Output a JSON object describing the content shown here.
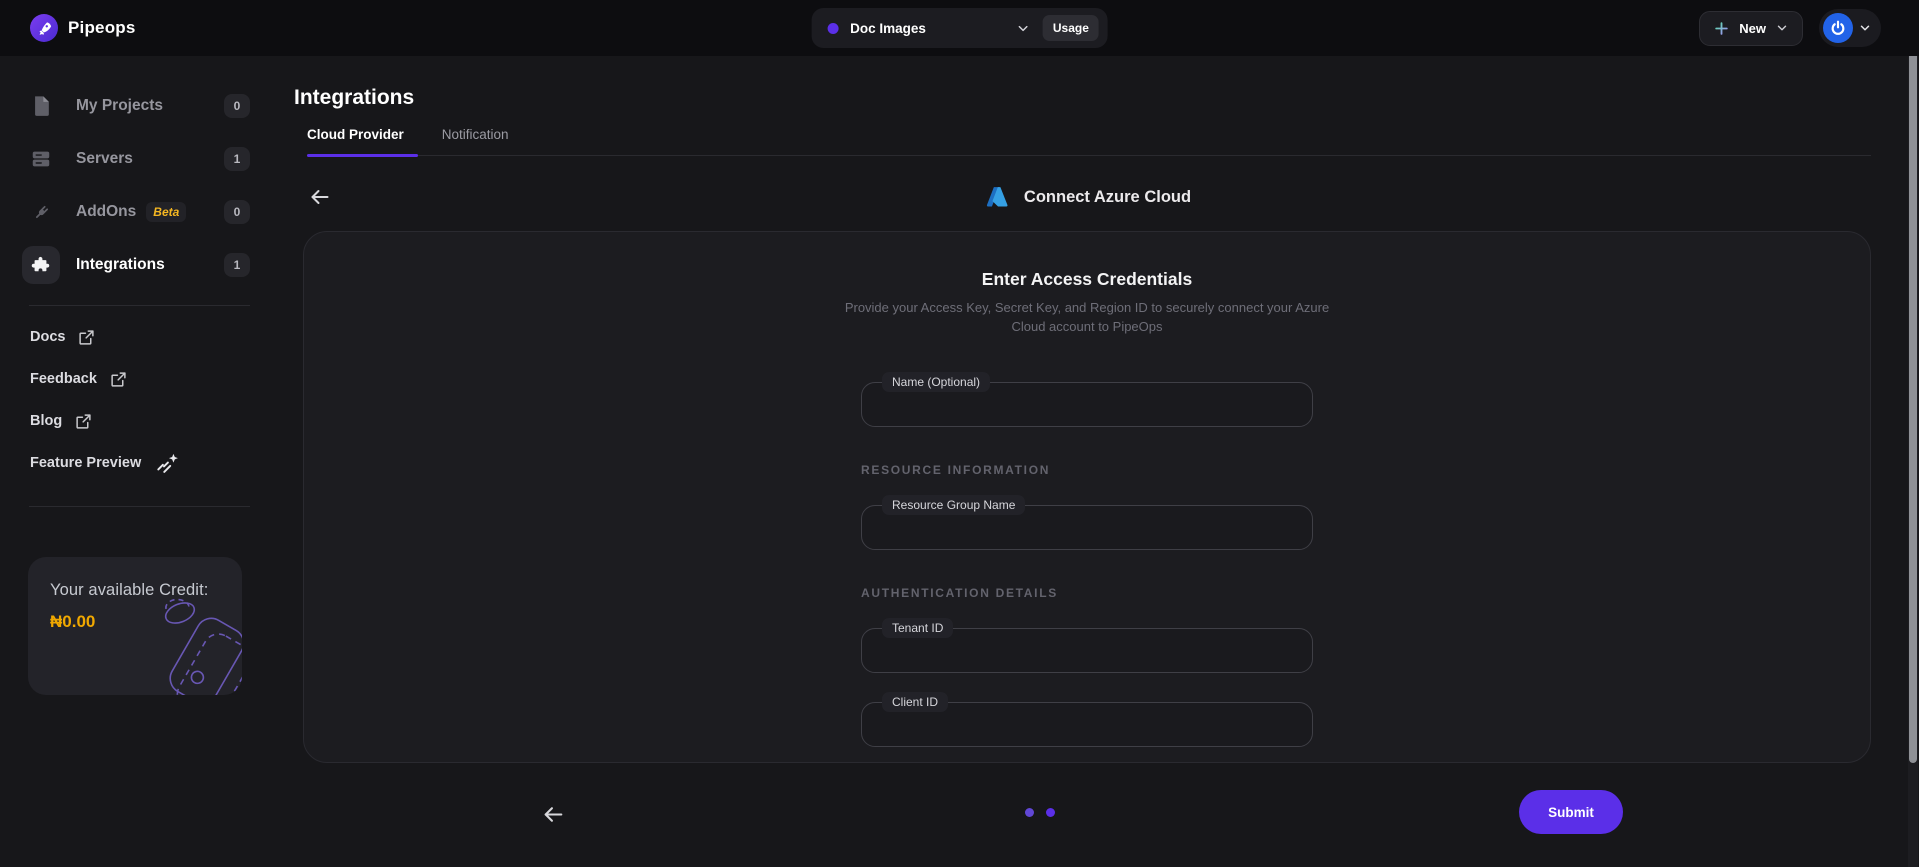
{
  "brand": {
    "name": "Pipeops"
  },
  "topbar": {
    "project": {
      "name": "Doc Images",
      "usage": "Usage"
    },
    "new_button": "New"
  },
  "sidebar": {
    "items": [
      {
        "label": "My Projects",
        "count": "0",
        "icon": "document-icon"
      },
      {
        "label": "Servers",
        "count": "1",
        "icon": "server-icon"
      },
      {
        "label": "AddOns",
        "beta": "Beta",
        "count": "0",
        "icon": "plug-icon"
      },
      {
        "label": "Integrations",
        "count": "1",
        "icon": "puzzle-icon",
        "active": true
      }
    ],
    "links": [
      {
        "label": "Docs",
        "icon": "external-link-icon"
      },
      {
        "label": "Feedback",
        "icon": "external-link-icon"
      },
      {
        "label": "Blog",
        "icon": "external-link-icon"
      },
      {
        "label": "Feature Preview",
        "icon": "shooting-star-icon"
      }
    ],
    "credit": {
      "label": "Your available Credit:",
      "amount": "₦0.00"
    }
  },
  "main": {
    "title": "Integrations",
    "tabs": [
      {
        "label": "Cloud Provider",
        "active": true
      },
      {
        "label": "Notification",
        "active": false
      }
    ],
    "provider": {
      "title": "Connect Azure Cloud",
      "icon": "azure-logo"
    },
    "form": {
      "heading": "Enter Access Credentials",
      "description": "Provide your Access Key, Secret Key, and Region ID to securely connect your Azure Cloud account to PipeOps",
      "name_field": {
        "label": "Name (Optional)",
        "value": "",
        "placeholder": ""
      },
      "resource_section": {
        "title": "RESOURCE INFORMATION",
        "fields": [
          {
            "label": "Resource Group Name",
            "value": "",
            "placeholder": ""
          }
        ]
      },
      "auth_section": {
        "title": "AUTHENTICATION DETAILS",
        "fields": [
          {
            "label": "Tenant ID",
            "value": "",
            "placeholder": ""
          },
          {
            "label": "Client ID",
            "value": "",
            "placeholder": ""
          }
        ]
      }
    },
    "footer": {
      "submit": "Submit",
      "pagination": {
        "dots": 2,
        "active_index": 1
      }
    }
  },
  "colors": {
    "accent": "#5B2FE8",
    "beta": "#F5B722",
    "credit_amount": "#F0A800",
    "azure_blue": "#35A0E4",
    "submit_bg": "#5B2FE8",
    "topbar_bg": "#0D0D10",
    "page_bg": "#17171A",
    "card_bg": "#1C1C20"
  }
}
